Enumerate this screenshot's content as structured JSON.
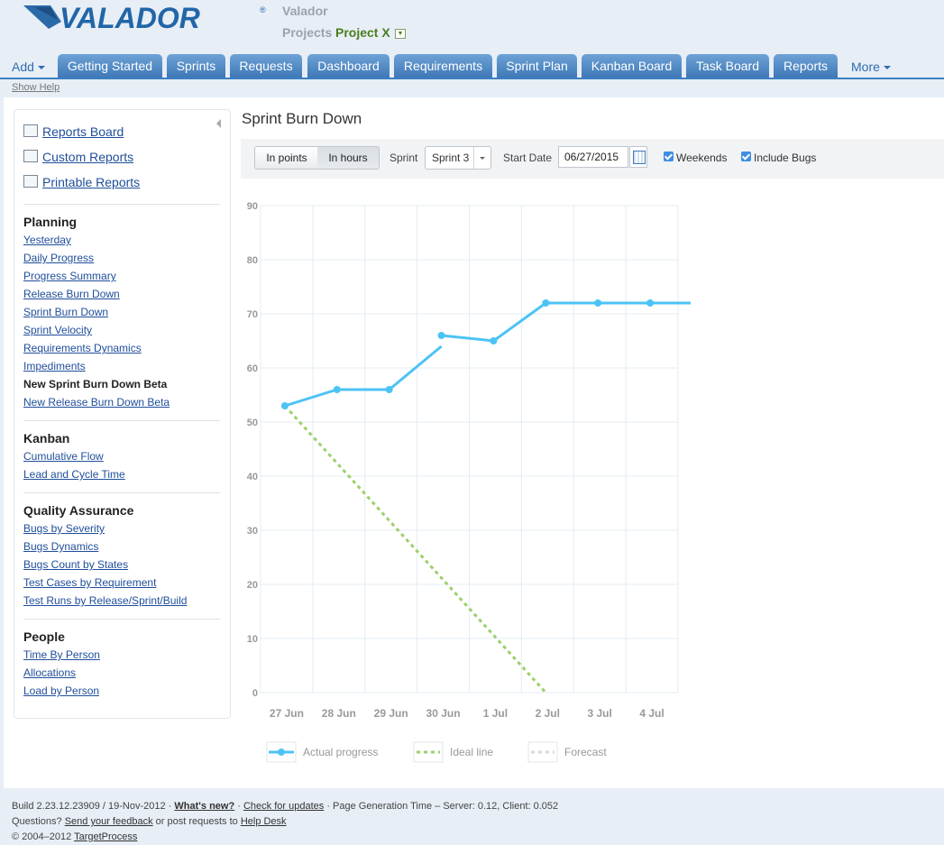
{
  "header": {
    "brand": "VALADOR",
    "org_name": "Valador",
    "projects_label": "Projects",
    "project_name": "Project X"
  },
  "nav": {
    "add_label": "Add",
    "more_label": "More",
    "tabs": [
      "Getting Started",
      "Sprints",
      "Requests",
      "Dashboard",
      "Requirements",
      "Sprint Plan",
      "Kanban Board",
      "Task Board",
      "Reports"
    ],
    "show_help": "Show Help"
  },
  "sidebar": {
    "top_links": [
      "Reports Board",
      "Custom Reports",
      "Printable Reports"
    ],
    "sections": [
      {
        "title": "Planning",
        "items": [
          "Yesterday",
          "Daily Progress",
          "Progress Summary",
          "Release Burn Down",
          "Sprint Burn Down",
          "Sprint Velocity",
          "Requirements Dynamics",
          "Impediments",
          "New Sprint Burn Down Beta",
          "New Release Burn Down Beta"
        ]
      },
      {
        "title": "Kanban",
        "items": [
          "Cumulative Flow",
          "Lead and Cycle Time"
        ]
      },
      {
        "title": "Quality Assurance",
        "items": [
          "Bugs by Severity",
          "Bugs Dynamics",
          "Bugs Count by States",
          "Test Cases by Requirement",
          "Test Runs by Release/Sprint/Build"
        ]
      },
      {
        "title": "People",
        "items": [
          "Time By Person",
          "Allocations",
          "Load by Person"
        ]
      }
    ]
  },
  "page": {
    "title": "Sprint Burn Down",
    "toolbar": {
      "in_points": "In points",
      "in_hours": "In hours",
      "sprint_label": "Sprint",
      "sprint_value": "Sprint 3",
      "start_date_label": "Start Date",
      "start_date_value": "06/27/2015",
      "weekends_label": "Weekends",
      "include_bugs_label": "Include Bugs"
    }
  },
  "chart_data": {
    "type": "line",
    "categories": [
      "27 Jun",
      "28 Jun",
      "29 Jun",
      "30 Jun",
      "1 Jul",
      "2 Jul",
      "3 Jul",
      "4 Jul"
    ],
    "ylim": [
      0,
      90
    ],
    "yticks": [
      0,
      10,
      20,
      30,
      40,
      50,
      60,
      70,
      80,
      90
    ],
    "grid": true,
    "legend_position": "bottom",
    "series": [
      {
        "name": "Actual progress",
        "color": "#4cc3f5",
        "style": "solid-markers",
        "points": [
          [
            0,
            53
          ],
          [
            1,
            56
          ],
          [
            2,
            56
          ],
          [
            3,
            64
          ],
          [
            3,
            66
          ],
          [
            4,
            65
          ],
          [
            5,
            72
          ],
          [
            6,
            72
          ],
          [
            7,
            72
          ],
          [
            8,
            72
          ]
        ]
      },
      {
        "name": "Ideal line",
        "color": "#9bd06a",
        "style": "dashed",
        "points": [
          [
            0,
            53
          ],
          [
            5,
            0
          ]
        ]
      },
      {
        "name": "Forecast",
        "color": "#d7dadd",
        "style": "dashed",
        "points": []
      }
    ]
  },
  "footer": {
    "build_text": "Build 2.23.12.23909 / 19-Nov-2012",
    "whats_new": "What's new?",
    "check_updates": "Check for updates",
    "gen_time": "· Page Generation Time – Server: 0.12, Client: 0.052",
    "questions": "Questions?",
    "send_feedback": "Send your feedback",
    "or_post": "or post requests to",
    "help_desk": "Help Desk",
    "copyright": "© 2004–2012",
    "tp_link": "TargetProcess"
  }
}
